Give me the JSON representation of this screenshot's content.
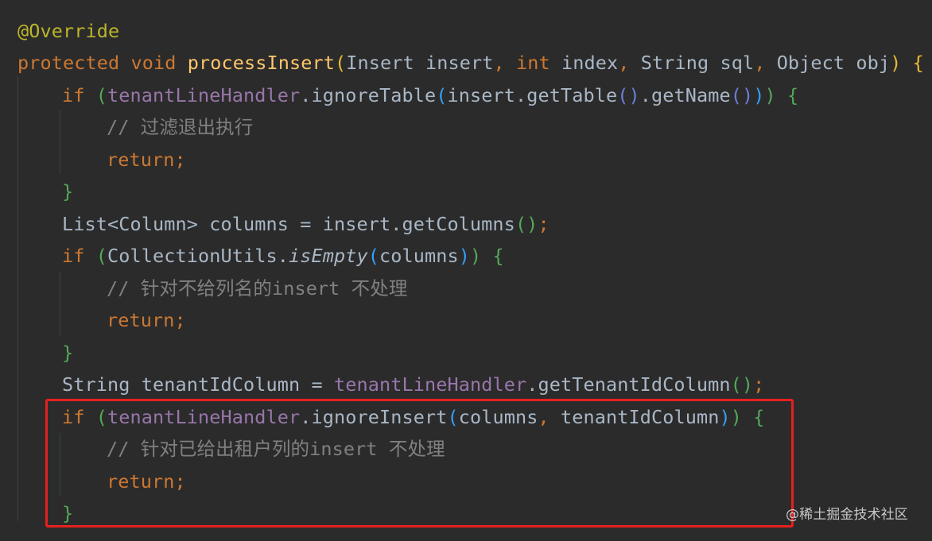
{
  "colors": {
    "background": "#2b2b2b",
    "highlight_box": "#e6201f",
    "annotation": "#bbb529",
    "keyword": "#cc7832",
    "plain": "#a9b7c6",
    "method": "#ffc66d",
    "field": "#9876aa",
    "comment": "#808080"
  },
  "code": {
    "lines": [
      [
        {
          "c": "ann",
          "t": "@Override"
        }
      ],
      [
        {
          "c": "kw",
          "t": "protected void "
        },
        {
          "c": "method",
          "t": "processInsert"
        },
        {
          "c": "p1",
          "t": "("
        },
        {
          "c": "plain",
          "t": "Insert insert"
        },
        {
          "c": "kw",
          "t": ", "
        },
        {
          "c": "kw",
          "t": "int "
        },
        {
          "c": "plain",
          "t": "index"
        },
        {
          "c": "kw",
          "t": ", "
        },
        {
          "c": "plain",
          "t": "String sql"
        },
        {
          "c": "kw",
          "t": ", "
        },
        {
          "c": "plain",
          "t": "Object obj"
        },
        {
          "c": "p1",
          "t": ")"
        },
        {
          "c": "plain",
          "t": " "
        },
        {
          "c": "p1",
          "t": "{"
        }
      ],
      [
        {
          "c": "kw",
          "t": "if "
        },
        {
          "c": "p2",
          "t": "("
        },
        {
          "c": "field",
          "t": "tenantLineHandler"
        },
        {
          "c": "plain",
          "t": ".ignoreTable"
        },
        {
          "c": "p3",
          "t": "("
        },
        {
          "c": "plain",
          "t": "insert.getTable"
        },
        {
          "c": "p4",
          "t": "()"
        },
        {
          "c": "plain",
          "t": ".getName"
        },
        {
          "c": "p4",
          "t": "()"
        },
        {
          "c": "p3",
          "t": ")"
        },
        {
          "c": "p2",
          "t": ")"
        },
        {
          "c": "plain",
          "t": " "
        },
        {
          "c": "p2",
          "t": "{"
        }
      ],
      [
        {
          "c": "comment",
          "t": "// 过滤退出执行"
        }
      ],
      [
        {
          "c": "kw",
          "t": "return;"
        }
      ],
      [
        {
          "c": "p2",
          "t": "}"
        }
      ],
      [
        {
          "c": "plain",
          "t": "List<Column> columns = insert.getColumns"
        },
        {
          "c": "p2",
          "t": "()"
        },
        {
          "c": "kw",
          "t": ";"
        }
      ],
      [
        {
          "c": "kw",
          "t": "if "
        },
        {
          "c": "p2",
          "t": "("
        },
        {
          "c": "plain",
          "t": "CollectionUtils."
        },
        {
          "c": "static-call",
          "t": "isEmpty"
        },
        {
          "c": "p3",
          "t": "("
        },
        {
          "c": "plain",
          "t": "columns"
        },
        {
          "c": "p3",
          "t": ")"
        },
        {
          "c": "p2",
          "t": ")"
        },
        {
          "c": "plain",
          "t": " "
        },
        {
          "c": "p2",
          "t": "{"
        }
      ],
      [
        {
          "c": "comment",
          "t": "// 针对不给列名的insert 不处理"
        }
      ],
      [
        {
          "c": "kw",
          "t": "return;"
        }
      ],
      [
        {
          "c": "p2",
          "t": "}"
        }
      ],
      [
        {
          "c": "plain",
          "t": "String tenantIdColumn = "
        },
        {
          "c": "field",
          "t": "tenantLineHandler"
        },
        {
          "c": "plain",
          "t": ".getTenantIdColumn"
        },
        {
          "c": "p2",
          "t": "()"
        },
        {
          "c": "kw",
          "t": ";"
        }
      ],
      [
        {
          "c": "kw",
          "t": "if "
        },
        {
          "c": "p2",
          "t": "("
        },
        {
          "c": "field",
          "t": "tenantLineHandler"
        },
        {
          "c": "plain",
          "t": ".ignoreInsert"
        },
        {
          "c": "p3",
          "t": "("
        },
        {
          "c": "plain",
          "t": "columns"
        },
        {
          "c": "kw",
          "t": ", "
        },
        {
          "c": "plain",
          "t": "tenantIdColumn"
        },
        {
          "c": "p3",
          "t": ")"
        },
        {
          "c": "p2",
          "t": ")"
        },
        {
          "c": "plain",
          "t": " "
        },
        {
          "c": "p2",
          "t": "{"
        }
      ],
      [
        {
          "c": "comment",
          "t": "// 针对已给出租户列的insert 不处理"
        }
      ],
      [
        {
          "c": "kw",
          "t": "return;"
        }
      ],
      [
        {
          "c": "p2",
          "t": "}"
        }
      ]
    ]
  },
  "watermark": "@稀土掘金技术社区"
}
